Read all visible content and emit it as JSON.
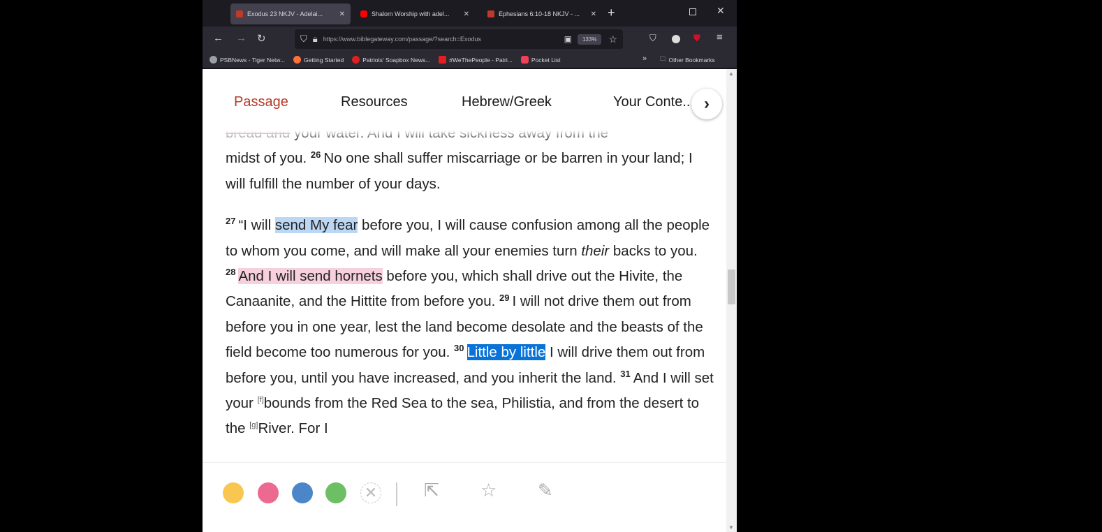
{
  "browser": {
    "tabs": [
      {
        "title": "Exodus 23 NKJV - Adelai...",
        "favicon_color": "#c0392b",
        "active": true
      },
      {
        "title": "Shalom Worship with adel...",
        "favicon_color": "#ff0000",
        "active": false
      },
      {
        "title": "Ephesians 6:10-18 NKJV - ...",
        "favicon_color": "#c0392b",
        "active": false
      }
    ],
    "new_tab": "+",
    "close_glyph": "✕",
    "nav": {
      "back": "←",
      "forward": "→",
      "reload": "↻"
    },
    "url": "https://www.biblegateway.com/passage/?search=Exodus",
    "zoom_level": "133%",
    "bookmarks": [
      {
        "label": "PSBNews - Tiger Netw...",
        "color": "#9aa0a6"
      },
      {
        "label": "Getting Started",
        "color": "#ff7139"
      },
      {
        "label": "Patriots' Soapbox News...",
        "color": "#e02020"
      },
      {
        "label": "#WeThePeople - Patri...",
        "color": "#e02020"
      },
      {
        "label": "Pocket List",
        "color": "#ef4056"
      }
    ],
    "bookmarks_overflow": "»",
    "other_bookmarks": "Other Bookmarks"
  },
  "page": {
    "subnav": {
      "tabs": [
        "Passage",
        "Resources",
        "Hebrew/Greek",
        "Your Conte..."
      ],
      "active_index": 0,
      "next": "›"
    },
    "passage": {
      "partial_top": {
        "struck": "bread and",
        "rest": " your water. And I will take sickness away from the"
      },
      "p1": {
        "start": "midst of you. ",
        "v26": "26",
        "v26_text": "No one shall suffer miscarriage or be barren in your land; I will fulfill the number of your days."
      },
      "p2": {
        "v27": "27",
        "v27_pre": "“I will ",
        "v27_hl": "send My fear",
        "v27_post": " before you, I will cause confusion among all the people to whom you come, and will make all your enemies turn ",
        "v27_italic": "their",
        "v27_end": " backs to you. ",
        "v28": "28",
        "v28_hl": "And I will send hornets",
        "v28_post": " before you, which shall drive out the Hivite, the Canaanite, and the Hittite from before you. ",
        "v29": "29",
        "v29_text": "I will not drive them out from before you in one year, lest the land become desolate and the beasts of the field become too numerous for you. ",
        "v30": "30",
        "v30_sel": "Little by little",
        "v30_post": " I will drive them out from before you, until you have increased, and you inherit the land. ",
        "v31": "31",
        "v31_pre": "And I will set your ",
        "fn_f": "[f]",
        "v31_mid": "bounds from the Red Sea to the sea, Philistia, and from the desert to the ",
        "fn_g": "[g]",
        "v31_end": "River. For I"
      }
    },
    "highlight_toolbar": {
      "colors": [
        {
          "name": "yellow",
          "hex": "#f9c74f"
        },
        {
          "name": "pink",
          "hex": "#ec6a8f"
        },
        {
          "name": "blue",
          "hex": "#4a86c8"
        },
        {
          "name": "green",
          "hex": "#6cbf63"
        }
      ],
      "clear": "✕",
      "share": "⇱",
      "favorite": "☆",
      "note": "✎"
    }
  }
}
